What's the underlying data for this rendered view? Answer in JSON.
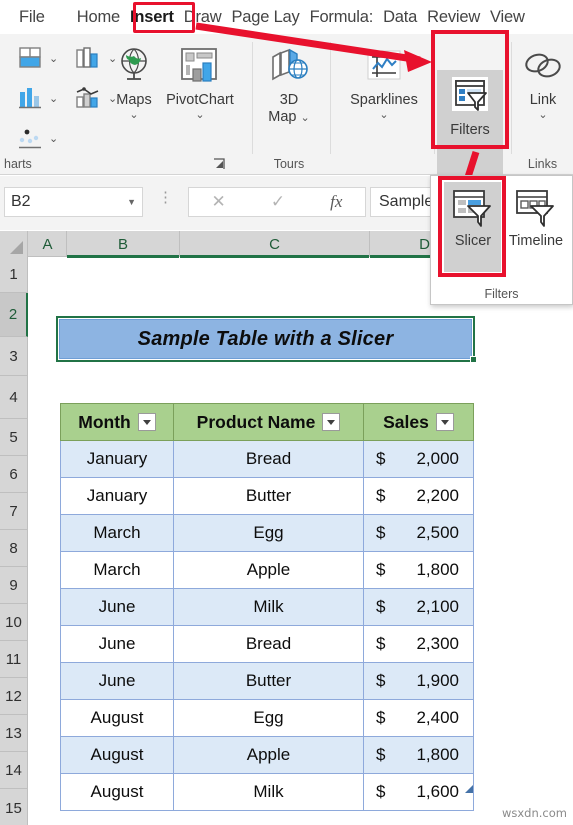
{
  "ribbon_tabs": [
    {
      "label": "File",
      "active": false
    },
    {
      "label": "Home",
      "active": false
    },
    {
      "label": "Insert",
      "active": true
    },
    {
      "label": "Draw",
      "active": false
    },
    {
      "label": "Page Lay",
      "active": false
    },
    {
      "label": "Formula:",
      "active": false
    },
    {
      "label": "Data",
      "active": false
    },
    {
      "label": "Review",
      "active": false
    },
    {
      "label": "View",
      "active": false
    }
  ],
  "ribbon": {
    "groups": [
      {
        "label": "harts"
      },
      {
        "label": "Tours"
      },
      {
        "label": "Links"
      }
    ],
    "buttons": {
      "maps": {
        "label": "Maps",
        "icon": "globe-map-icon"
      },
      "pivotchart": {
        "label": "PivotChart",
        "icon": "pivotchart-icon"
      },
      "map3d": {
        "label": "3D",
        "label2": "Map",
        "icon": "3d-map-icon"
      },
      "sparklines": {
        "label": "Sparklines",
        "icon": "sparklines-icon"
      },
      "filters": {
        "label": "Filters",
        "icon": "filters-icon"
      },
      "link": {
        "label": "Link",
        "icon": "link-icon"
      }
    }
  },
  "filters_dropdown": {
    "group_label": "Filters",
    "items": [
      {
        "label": "Slicer",
        "icon": "slicer-icon",
        "selected": true
      },
      {
        "label": "Timeline",
        "icon": "timeline-icon",
        "selected": false
      }
    ]
  },
  "formula_bar": {
    "name_box": "B2",
    "cancel_icon": "cancel-x-icon",
    "confirm_icon": "confirm-check-icon",
    "function_icon": "fx-icon",
    "value": "Sample T"
  },
  "grid": {
    "columns": [
      {
        "label": "A",
        "selected": false
      },
      {
        "label": "B",
        "selected": true
      },
      {
        "label": "C",
        "selected": true
      },
      {
        "label": "D",
        "selected": true
      }
    ],
    "rows": [
      "1",
      "2",
      "3",
      "4",
      "5",
      "6",
      "7",
      "8",
      "9",
      "10",
      "11",
      "12",
      "13",
      "14",
      "15"
    ],
    "active_row": "2"
  },
  "sheet": {
    "title_cell": "Sample Table with a Slicer",
    "table": {
      "headers": [
        "Month",
        "Product Name",
        "Sales"
      ],
      "rows": [
        {
          "month": "January",
          "product": "Bread",
          "currency": "$",
          "sales": "2,000"
        },
        {
          "month": "January",
          "product": "Butter",
          "currency": "$",
          "sales": "2,200"
        },
        {
          "month": "March",
          "product": "Egg",
          "currency": "$",
          "sales": "2,500"
        },
        {
          "month": "March",
          "product": "Apple",
          "currency": "$",
          "sales": "1,800"
        },
        {
          "month": "June",
          "product": "Milk",
          "currency": "$",
          "sales": "2,100"
        },
        {
          "month": "June",
          "product": "Bread",
          "currency": "$",
          "sales": "2,300"
        },
        {
          "month": "June",
          "product": "Butter",
          "currency": "$",
          "sales": "1,900"
        },
        {
          "month": "August",
          "product": "Egg",
          "currency": "$",
          "sales": "2,400"
        },
        {
          "month": "August",
          "product": "Apple",
          "currency": "$",
          "sales": "1,800"
        },
        {
          "month": "August",
          "product": "Milk",
          "currency": "$",
          "sales": "1,600"
        }
      ]
    }
  },
  "watermark": "wsxdn.com",
  "colors": {
    "annotation_red": "#e8112d",
    "header_green": "#a9d08e",
    "banded_blue": "#dce9f7",
    "title_blue": "#8db4e2",
    "selection_green": "#217346"
  }
}
